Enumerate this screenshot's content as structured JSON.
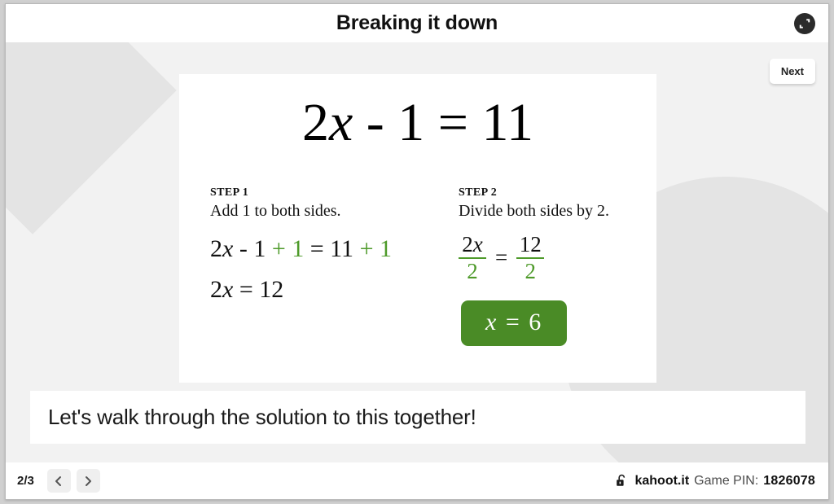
{
  "header": {
    "title": "Breaking it down",
    "fullscreen_icon": "fullscreen-expand-icon"
  },
  "stage": {
    "next_button": "Next",
    "media": {
      "main_equation": {
        "lhs_coefficient": "2",
        "lhs_variable": "x",
        "minus": " - ",
        "lhs_constant": "1",
        "equals": " = ",
        "rhs": "11",
        "full": "2x - 1 = 11"
      },
      "steps": [
        {
          "label": "STEP 1",
          "description": "Add 1 to both sides.",
          "line_1": {
            "part_a": "2",
            "var": "x",
            "part_b": " - 1 ",
            "highlight_a": "+ 1",
            "part_c": " = 11 ",
            "highlight_b": "+ 1"
          },
          "line_2": {
            "part_a": "2",
            "var": "x",
            "part_b": " = 12"
          }
        },
        {
          "label": "STEP 2",
          "description": "Divide both sides by 2.",
          "fraction_left": {
            "numerator_coef": "2",
            "numerator_var": "x",
            "denominator": "2"
          },
          "equals": "=",
          "fraction_right": {
            "numerator": "12",
            "denominator": "2"
          },
          "answer": {
            "var": "x",
            "equals": "=",
            "value": "6"
          }
        }
      ]
    },
    "caption": "Let's walk through the solution to this together!"
  },
  "footer": {
    "page_indicator": "2/3",
    "prev_icon": "chevron-left-icon",
    "next_icon": "chevron-right-icon",
    "lock_icon": "open-padlock-icon",
    "brand": "kahoot.it",
    "pin_label": "Game PIN:",
    "pin_value": "1826078"
  },
  "colors": {
    "accent_green": "#4e9a2a",
    "answer_green": "#4a8b26",
    "stage_bg": "#f2f2f2",
    "deco_gray": "#e4e4e4"
  }
}
